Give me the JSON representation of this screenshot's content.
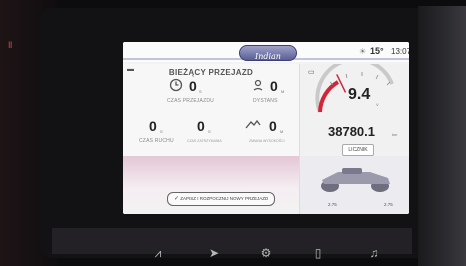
{
  "status_bar": {
    "brand": "Indian",
    "temperature": "15°",
    "time": "13:07"
  },
  "trip": {
    "title": "BIEŻĄCY PRZEJAZD",
    "trip_time": {
      "value": "0",
      "unit": "S",
      "label": "CZAS PRZEJAZDU"
    },
    "distance": {
      "value": "0",
      "unit": "M",
      "label": "DYSTANS"
    },
    "moving_time": {
      "value": "0",
      "unit": "S",
      "label": "CZAS RUCHU"
    },
    "stopped_time": {
      "value": "0",
      "unit": "S",
      "label": "CZAS ZATRZYMANIA"
    },
    "elevation_change": {
      "value": "0",
      "unit": "M",
      "label": "ZMIANA WYSOKOŚCI"
    },
    "save_button": "ZAPISZ I ROZPOCZNIJ NOWY PRZEJAZD"
  },
  "gauge": {
    "battery_value": "9.4",
    "battery_unit": "V",
    "battery_fraction": 0.34,
    "odometer": "38780.1",
    "odometer_unit": "km",
    "counter_button": "LICZNIK"
  },
  "bike": {
    "left_value": "2.75",
    "right_value": "2.75"
  },
  "icons": [
    "clock-icon",
    "distance-icon",
    "elevation-icon",
    "battery-icon",
    "weather-icon",
    "collapse-icon",
    "check-icon",
    "navigation-icon",
    "settings-icon",
    "phone-icon",
    "music-icon",
    "ride-command-icon"
  ]
}
